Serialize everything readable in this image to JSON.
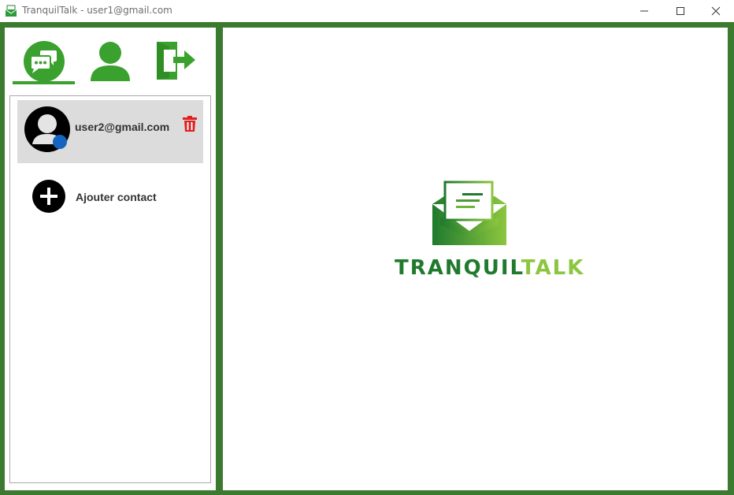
{
  "window": {
    "title": "TranquilTalk - user1@gmail.com",
    "app_icon": "envelope-icon",
    "controls": [
      "minimize-icon",
      "maximize-icon",
      "close-icon"
    ]
  },
  "nav": {
    "items": [
      {
        "name": "chats",
        "icon": "chat-bubbles-icon",
        "active": true
      },
      {
        "name": "profile",
        "icon": "user-icon",
        "active": false
      },
      {
        "name": "logout",
        "icon": "exit-door-icon",
        "active": false
      }
    ]
  },
  "contacts": [
    {
      "email": "user2@gmail.com",
      "status_color": "#1565c0",
      "delete_icon": "trash-icon"
    }
  ],
  "add_contact": {
    "label": "Ajouter contact",
    "icon": "plus-circle-icon"
  },
  "brand": {
    "part1": "TRANQUIL",
    "part2": "TALK",
    "icon": "envelope-letter-icon"
  },
  "colors": {
    "frame": "#3b7a2f",
    "accent": "#3aa12e",
    "brand_dark": "#1f7a2e",
    "brand_light": "#8cc63f",
    "delete": "#e02020",
    "selected_row": "#dcdcdc"
  }
}
